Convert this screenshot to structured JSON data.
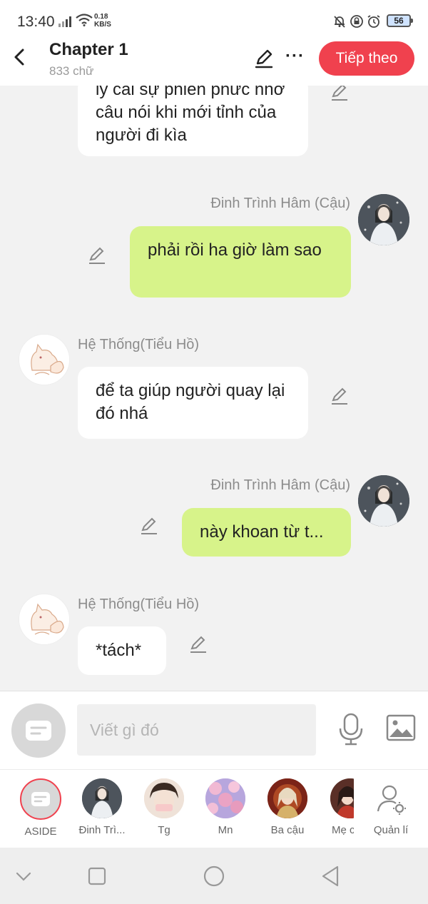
{
  "status_bar": {
    "time": "13:40",
    "net_speed_value": "0.18",
    "net_speed_unit": "KB/S",
    "battery": "56"
  },
  "header": {
    "title": "Chapter 1",
    "subtitle": "833 chữ",
    "next_label": "Tiếp theo",
    "accent_color": "#f0414e"
  },
  "messages": [
    {
      "side": "left",
      "text": "ly cái sự phiền phức nhờ câu nói khi mới tỉnh của người đi kìa"
    },
    {
      "side": "right",
      "sender": "Đinh Trình Hâm (Cậu)",
      "text": "phải rồi ha giờ làm sao"
    },
    {
      "side": "left",
      "sender": "Hệ Thống(Tiểu Hồ)",
      "text": "để ta giúp người quay lại đó nhá"
    },
    {
      "side": "right",
      "sender": "Đinh Trình Hâm (Cậu)",
      "text": "này khoan từ t..."
    },
    {
      "side": "left",
      "sender": "Hệ Thống(Tiểu Hồ)",
      "text": "*tách*"
    }
  ],
  "input": {
    "placeholder": "Viết gì đó"
  },
  "characters": [
    {
      "label": "ASIDE"
    },
    {
      "label": "Đinh Trì..."
    },
    {
      "label": "Tg"
    },
    {
      "label": "Mn"
    },
    {
      "label": "Ba cậu"
    },
    {
      "label": "Mẹ c"
    },
    {
      "label": "Quản lí"
    }
  ],
  "colors": {
    "green_bubble": "#d7f38a",
    "white_bubble": "#ffffff",
    "background": "#f2f2f2"
  }
}
